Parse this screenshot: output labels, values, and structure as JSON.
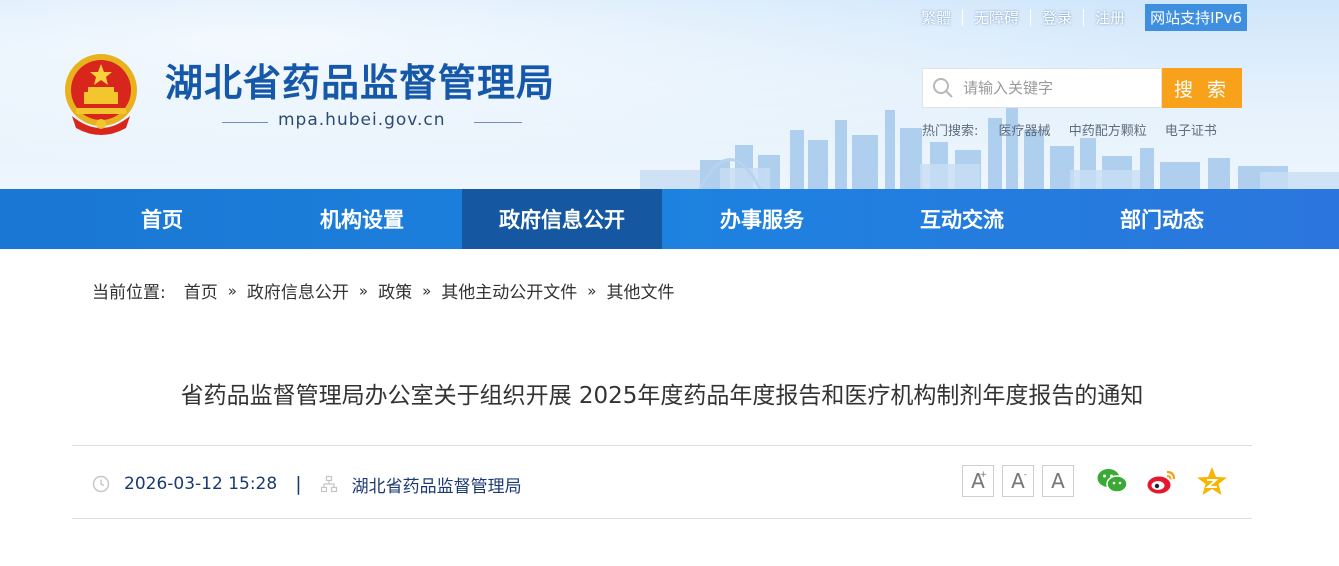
{
  "header": {
    "site_title": "湖北省药品监督管理局",
    "site_url": "mpa.hubei.gov.cn",
    "toplinks": [
      "繁體",
      "无障碍",
      "登录",
      "注册"
    ],
    "ipv6": "网站支持IPv6",
    "search": {
      "placeholder": "请输入关键字",
      "button": "搜 索"
    },
    "hot": {
      "label": "热门搜索:",
      "terms": [
        "医疗器械",
        "中药配方颗粒",
        "电子证书"
      ]
    }
  },
  "nav": {
    "items": [
      "首页",
      "机构设置",
      "政府信息公开",
      "办事服务",
      "互动交流",
      "部门动态"
    ],
    "active_index": 2
  },
  "breadcrumb": {
    "label": "当前位置:",
    "items": [
      "首页",
      "政府信息公开",
      "政策",
      "其他主动公开文件",
      "其他文件"
    ],
    "separator": "»"
  },
  "article": {
    "title": "省药品监督管理局办公室关于组织开展 2025年度药品年度报告和医疗机构制剂年度报告的通知",
    "datetime": "2026-03-12 15:28",
    "divider": "|",
    "source": "湖北省药品监督管理局"
  },
  "font_tools": {
    "increase": "A",
    "increase_sup": "+",
    "decrease": "A",
    "decrease_sup": "-",
    "reset": "A"
  },
  "share": [
    "wechat-icon",
    "weibo-icon",
    "qzone-icon"
  ],
  "colors": {
    "nav_bg": "#1d82df",
    "nav_active": "#1557a0",
    "title_blue": "#1557a8",
    "search_button": "#f7a21a"
  }
}
